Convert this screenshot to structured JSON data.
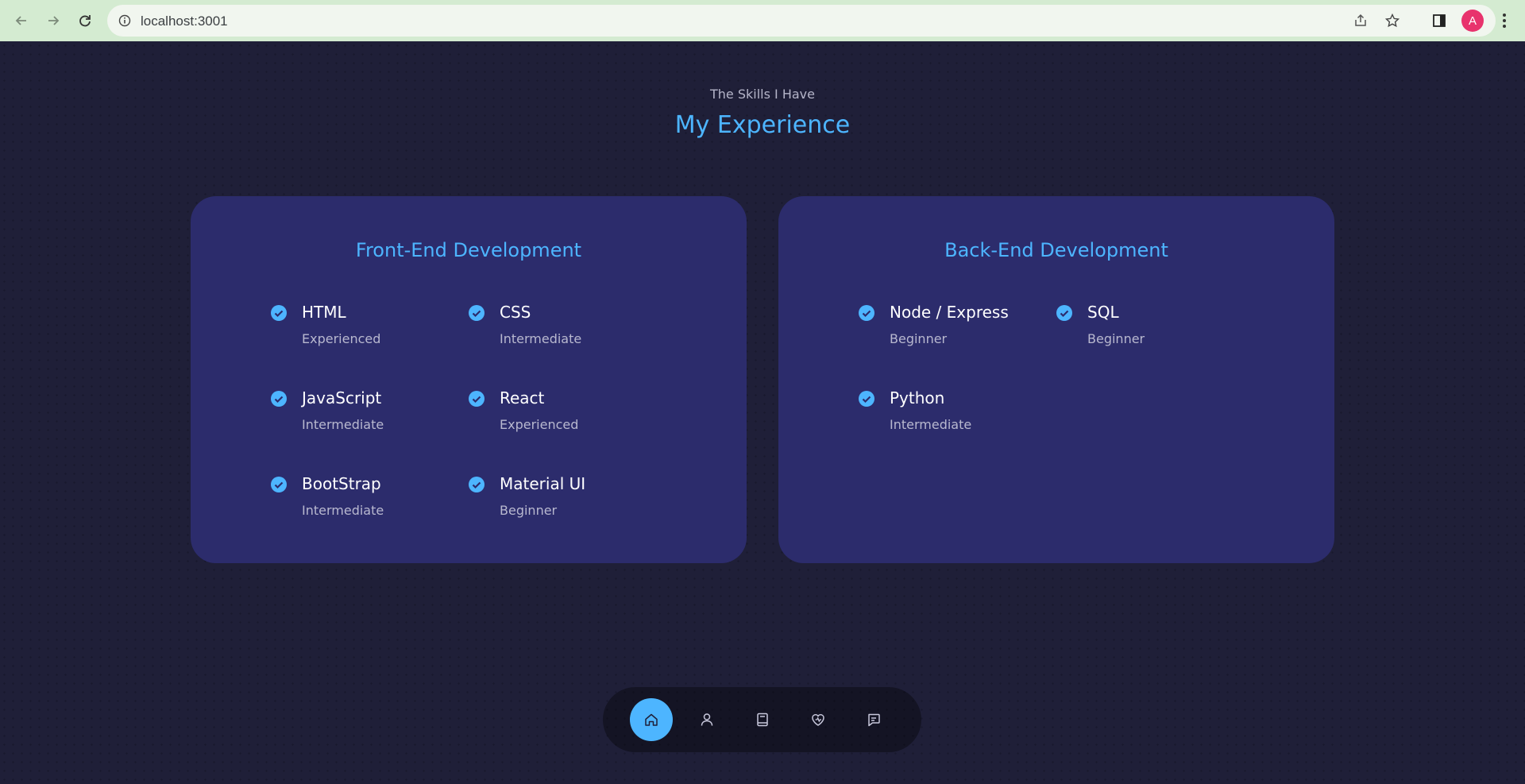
{
  "browser": {
    "url": "localhost:3001",
    "profile_initial": "A",
    "icons": [
      "back-arrow-icon",
      "forward-arrow-icon",
      "reload-icon",
      "info-icon",
      "share-icon",
      "star-icon",
      "side-panel-icon",
      "menu-dots-icon"
    ]
  },
  "header": {
    "subtitle": "The Skills I Have",
    "title": "My Experience"
  },
  "cards": [
    {
      "title": "Front-End Development",
      "skills": [
        {
          "name": "HTML",
          "level": "Experienced"
        },
        {
          "name": "CSS",
          "level": "Intermediate"
        },
        {
          "name": "JavaScript",
          "level": "Intermediate"
        },
        {
          "name": "React",
          "level": "Experienced"
        },
        {
          "name": "BootStrap",
          "level": "Intermediate"
        },
        {
          "name": "Material UI",
          "level": "Beginner"
        }
      ]
    },
    {
      "title": "Back-End Development",
      "skills": [
        {
          "name": "Node / Express",
          "level": "Beginner"
        },
        {
          "name": "SQL",
          "level": "Beginner"
        },
        {
          "name": "Python",
          "level": "Intermediate"
        }
      ]
    }
  ],
  "bottom_nav": {
    "items": [
      "home-icon",
      "user-icon",
      "book-icon",
      "services-icon",
      "message-icon"
    ],
    "active": "home-icon"
  },
  "colors": {
    "accent": "#4db5ff",
    "card_bg": "#2c2c6c",
    "page_bg": "#1f1f38"
  }
}
